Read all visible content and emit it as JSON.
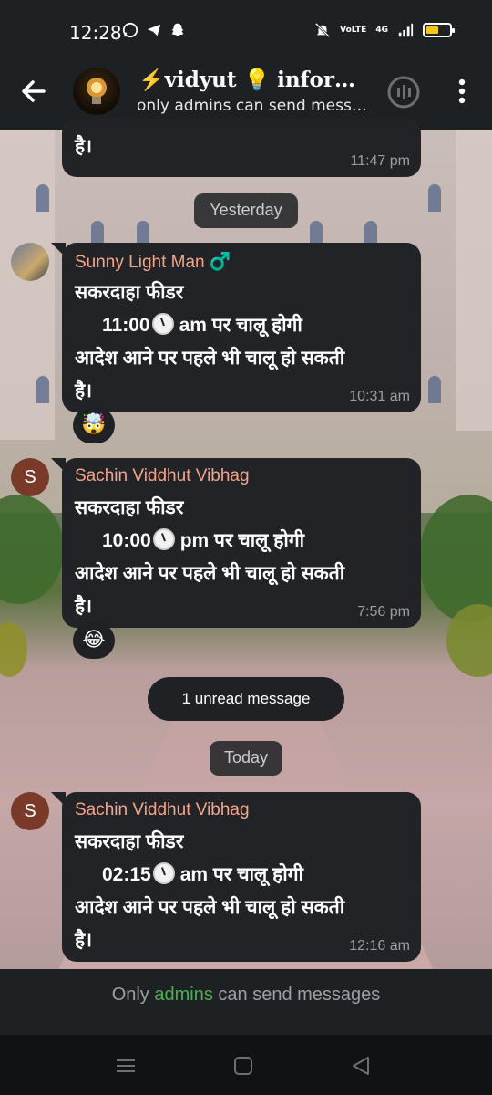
{
  "status_bar": {
    "time": "12:28",
    "icons_left": [
      "whatsapp-icon",
      "telegram-icon",
      "snapchat-icon"
    ],
    "icons_right": [
      "mute-icon",
      "volte-icon",
      "4g-signal-icon",
      "signal-bars-icon",
      "battery-icon"
    ],
    "network_label": "VoLTE",
    "network_type": "4G",
    "battery_level": 0.55,
    "battery_color": "#f5c518"
  },
  "header": {
    "title": "⚡vidyut 💡 inform...",
    "subtitle": "only admins can send messa...",
    "avatar_icon": "bulb-icon"
  },
  "messages": [
    {
      "lines": [
        "है।"
      ],
      "time": "11:47 pm"
    },
    {
      "date_separator": "Yesterday"
    },
    {
      "sender": "Sunny Light Man ♂️",
      "lines": [
        "सकरदाहा फीडर",
        "11:00",
        "am पर चालू होगी",
        "आदेश आने पर पहले भी चालू हो सकती",
        "है।"
      ],
      "time": "10:31 am",
      "reaction": "🤯",
      "avatar": "photo"
    },
    {
      "sender": "Sachin Viddhut Vibhag",
      "avatar_letter": "S",
      "lines": [
        "सकरदाहा फीडर",
        "10:00",
        "pm पर चालू होगी",
        "आदेश आने पर पहले भी चालू हो सकती",
        "है।"
      ],
      "time": "7:56 pm",
      "reaction": "😂"
    },
    {
      "unread": "1 unread message"
    },
    {
      "date_separator": "Today"
    },
    {
      "sender": "Sachin Viddhut Vibhag",
      "avatar_letter": "S",
      "lines": [
        "सकरदाहा फीडर",
        "02:15",
        "am पर चालू होगी",
        "आदेश आने पर पहले भी चालू हो सकती",
        "है।"
      ],
      "time": "12:16 am"
    }
  ],
  "footer": {
    "prefix": "Only ",
    "highlight": "admins",
    "suffix": " can send messages",
    "highlight_color": "#4caf50"
  },
  "nav": [
    "recents-icon",
    "home-icon",
    "back-triangle-icon"
  ]
}
